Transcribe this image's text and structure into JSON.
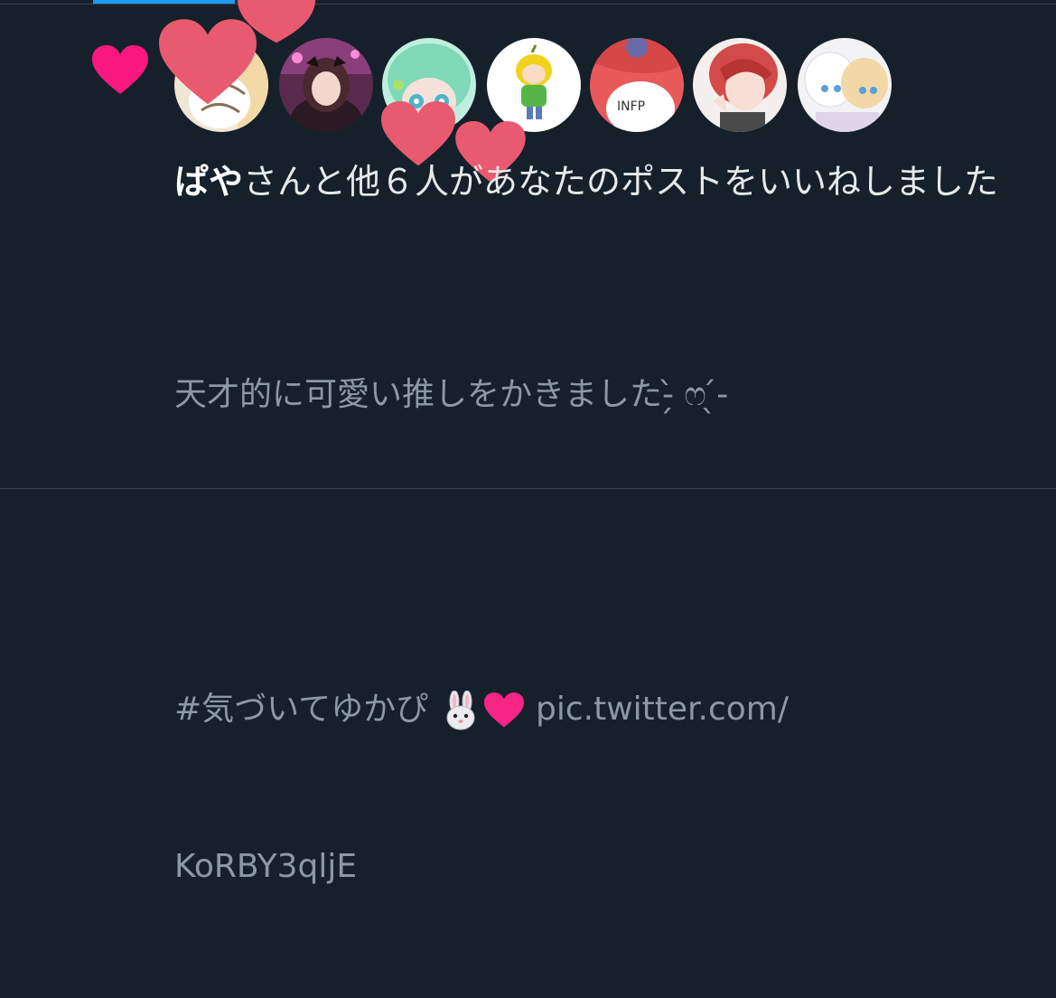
{
  "notification": {
    "icon": "heart-icon",
    "accent_color": "#f91880",
    "actor_name": "ぱや",
    "message": "さんと他６人があなたのポストをいいねしました",
    "avatar_count": 7
  },
  "tweet": {
    "line1": "天才的に可愛い推しをかきました-̗̀ ෆ ̖́-",
    "hashtag": "#気づいてゆかぴ",
    "emoji_1": "rabbit-face-emoji",
    "emoji_2": "pink-heart-emoji",
    "link_part1": "pic.twitter.com/",
    "link_part2": "KoRBY3qljE"
  },
  "colors": {
    "background": "#15202b",
    "primary_text": "#e7e9ea",
    "secondary_text": "#8b98a5",
    "divider": "#38444d",
    "tab_indicator": "#1d9bf0",
    "overlay_heart": "#e85a70"
  }
}
